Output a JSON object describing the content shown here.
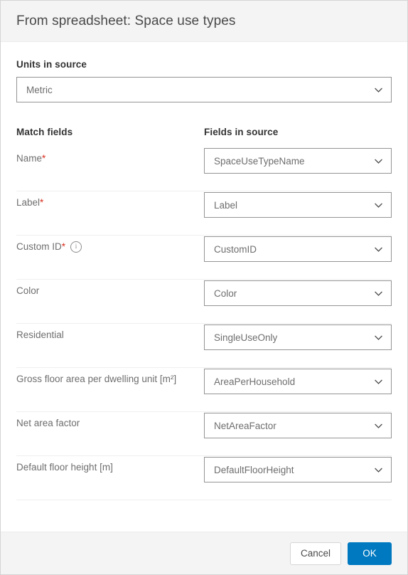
{
  "dialog": {
    "title": "From spreadsheet: Space use types"
  },
  "units": {
    "label": "Units in source",
    "value": "Metric"
  },
  "match": {
    "left_header": "Match fields",
    "right_header": "Fields in source",
    "rows": [
      {
        "label": "Name",
        "required": "*",
        "info": false,
        "value": "SpaceUseTypeName"
      },
      {
        "label": "Label",
        "required": "*",
        "info": false,
        "value": "Label"
      },
      {
        "label": "Custom ID",
        "required": "*",
        "info": true,
        "info_icon": "info-circle-icon",
        "value": "CustomID"
      },
      {
        "label": "Color",
        "required": "",
        "info": false,
        "value": "Color"
      },
      {
        "label": "Residential",
        "required": "",
        "info": false,
        "value": "SingleUseOnly"
      },
      {
        "label": "Gross floor area per dwelling unit [m²]",
        "required": "",
        "info": false,
        "value": "AreaPerHousehold"
      },
      {
        "label": "Net area factor",
        "required": "",
        "info": false,
        "value": "NetAreaFactor"
      },
      {
        "label": "Default floor height [m]",
        "required": "",
        "info": false,
        "value": "DefaultFloorHeight"
      }
    ]
  },
  "footer": {
    "cancel_label": "Cancel",
    "ok_label": "OK"
  },
  "colors": {
    "accent": "#0079c1",
    "required_asterisk": "#d83020",
    "header_bg": "#f4f4f4",
    "control_border": "#949494",
    "row_divider": "#efefef"
  },
  "icons": {
    "chevron": "chevron-down-icon"
  }
}
